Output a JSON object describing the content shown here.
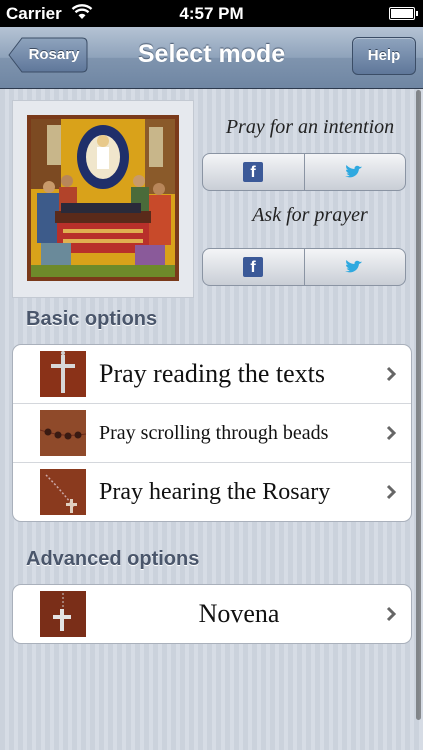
{
  "status_bar": {
    "carrier": "Carrier",
    "time": "4:57 PM"
  },
  "nav": {
    "title": "Select mode",
    "back_label": "Rosary",
    "help_label": "Help"
  },
  "share": {
    "intention_caption": "Pray for an intention",
    "prayer_caption": "Ask for prayer",
    "facebook_glyph": "f",
    "icons": [
      "facebook-icon",
      "twitter-icon"
    ]
  },
  "sections": {
    "basic": "Basic options",
    "advanced": "Advanced options"
  },
  "basic_options": [
    {
      "label": "Pray reading the texts"
    },
    {
      "label": "Pray scrolling through beads"
    },
    {
      "label": "Pray hearing the Rosary"
    }
  ],
  "advanced_options": [
    {
      "label": "Novena"
    }
  ],
  "colors": {
    "nav_gradient_top": "#b5c3d4",
    "nav_gradient_bottom": "#6f86a3",
    "section_header": "#4a566b",
    "facebook": "#3b5998",
    "twitter": "#2fa9e0"
  }
}
